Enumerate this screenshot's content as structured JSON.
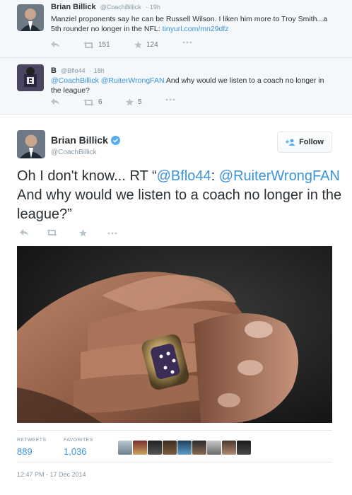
{
  "tweets": [
    {
      "name": "Brian Billick",
      "handle": "@CoachBillick",
      "time": "19h",
      "text_pre": "Manziel proponents say he can be Russell Wilson. I liken him more to Troy Smith...a 5th rounder no longer in the NFL: ",
      "link": "tinyurl.com/mn29dfz",
      "retweets": "151",
      "favorites": "124"
    },
    {
      "name": "B",
      "handle": "@Bflo44",
      "time": "18h",
      "mentions": "@CoachBillick @RuiterWrongFAN",
      "text_post": " And why would we listen to a coach no longer in the league?",
      "retweets": "6",
      "favorites": "5"
    }
  ],
  "main": {
    "name": "Brian Billick",
    "handle": "@CoachBillick",
    "follow_label": "Follow",
    "text_pre": "Oh I don't know... RT “",
    "mention1": "@Bflo44",
    "text_mid": ": ",
    "mention2": "@RuiterWrongFAN",
    "text_post": " And why would we listen to a coach no longer in the league?”",
    "retweets_label": "RETWEETS",
    "retweets": "889",
    "favorites_label": "FAVORITES",
    "favorites": "1,036",
    "date": "12:47 PM - 17 Dec 2014"
  },
  "icons": [
    "reply-icon",
    "retweet-icon",
    "favorite-icon",
    "more-icon",
    "verified-badge-icon",
    "follow-person-icon"
  ],
  "colors": {
    "link": "#3b94d9",
    "meta": "#8899a6",
    "verified": "#55acee"
  }
}
